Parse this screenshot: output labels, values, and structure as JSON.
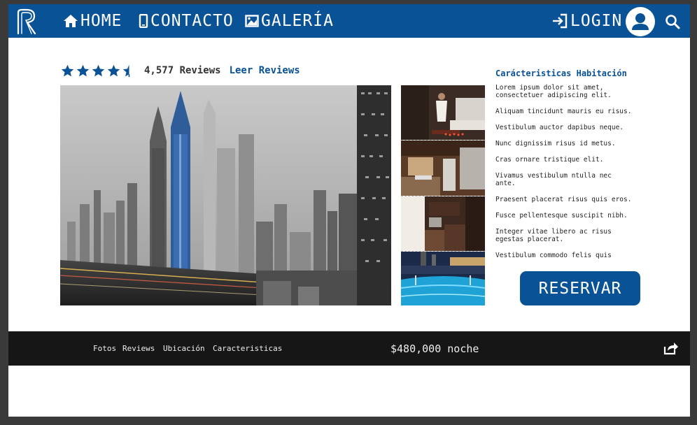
{
  "nav": {
    "home_label": "HOME",
    "contact_label": "CONTACTO",
    "gallery_label": "GALERÍA",
    "login_label": "LOGIN"
  },
  "rating": {
    "stars": 4.5,
    "reviews_count": "4,577 Reviews",
    "reviews_link": "Leer Reviews"
  },
  "features": {
    "title": "Carácteristicas Habitación",
    "items": [
      "Lorem ipsum dolor sit amet, consectetuer adipiscing elit.",
      "Aliquam tincidunt mauris eu risus.",
      "Vestibulum auctor dapibus neque.",
      "Nunc dignissim risus id metus.",
      "Cras ornare tristique elit.",
      "Vivamus vestibulum ntulla nec ante.",
      "Praesent placerat risus quis eros.",
      "Fusce pellentesque suscipit nibh.",
      "Integer vitae libero ac risus egestas placerat.",
      "Vestibulum commodo felis quis"
    ]
  },
  "reserve_label": "RESERVAR",
  "bottom": {
    "tabs": [
      "Fotos",
      "Reviews",
      "Ubicación",
      "Caracteristicas"
    ],
    "price": "$480,000 noche"
  },
  "colors": {
    "brand_blue": "#0a5296",
    "bar_dark": "#161616",
    "page_bg": "#3a3a3a"
  },
  "icons": [
    "logo-r",
    "home-icon",
    "phone-icon",
    "image-icon",
    "login-icon",
    "user-icon",
    "search-icon",
    "star-icon",
    "share-icon"
  ]
}
